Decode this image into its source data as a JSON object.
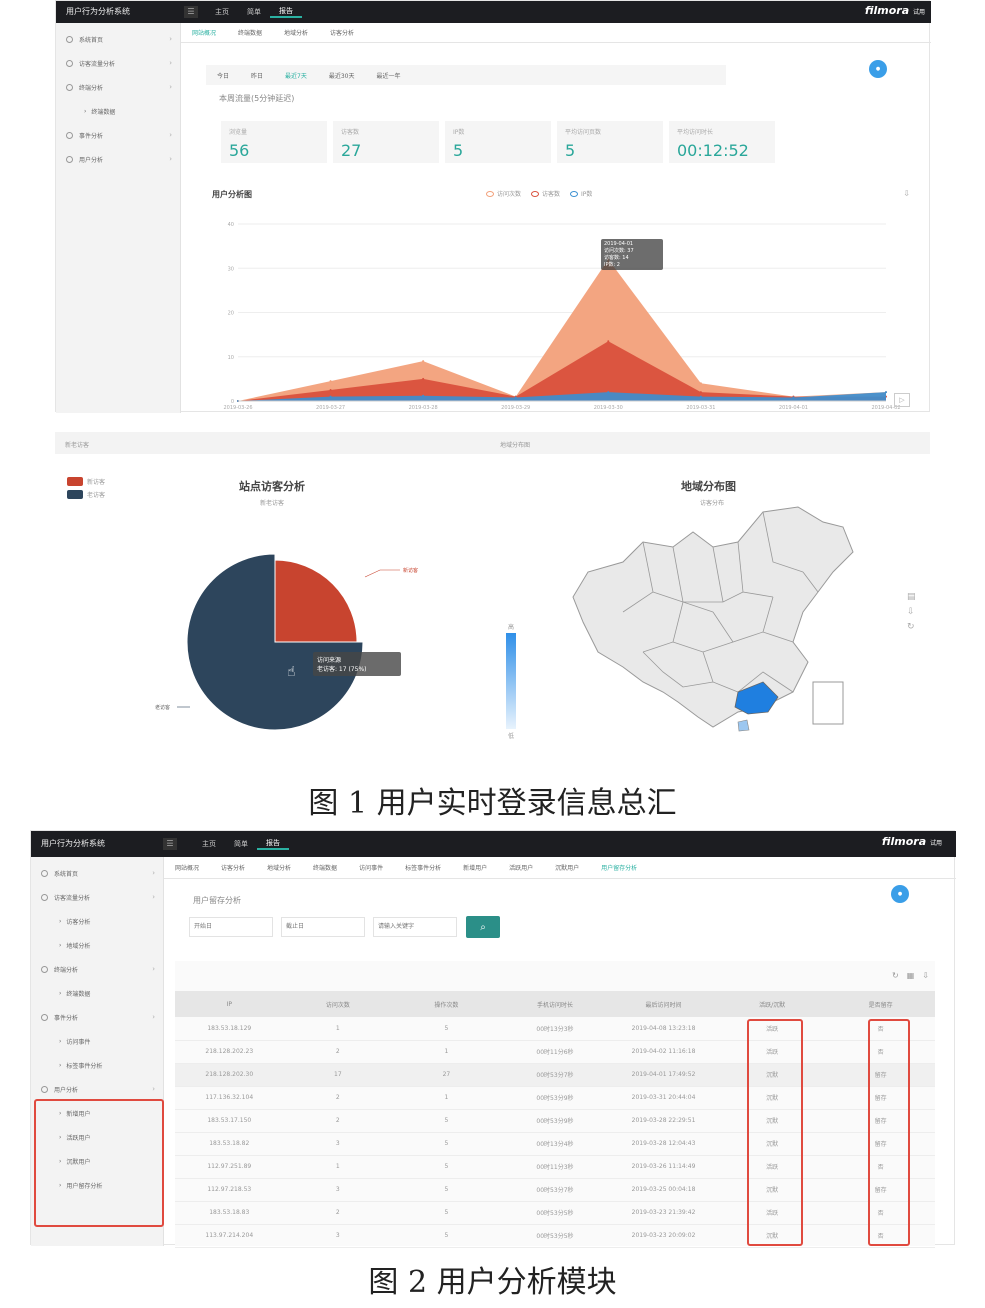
{
  "fig1": {
    "app_title": "用户行为分析系统",
    "brand": "filmora",
    "brand_suffix": "试用",
    "topnav": [
      "主页",
      "简单",
      "报告"
    ],
    "sidebar": [
      {
        "label": "系统首页",
        "sub": false
      },
      {
        "label": "访客流量分析",
        "sub": false
      },
      {
        "label": "终端分析",
        "sub": false
      },
      {
        "label": "终端数据",
        "sub": true
      },
      {
        "label": "事件分析",
        "sub": false
      },
      {
        "label": "用户分析",
        "sub": false
      }
    ],
    "page_tabs": [
      "网站概况",
      "终端数据",
      "地域分析",
      "访客分析"
    ],
    "range_tabs": [
      "今日",
      "昨日",
      "最近7天",
      "最近30天",
      "最近一年"
    ],
    "section_title": "本周流量(5分钟延迟)",
    "stats": [
      {
        "label": "浏览量",
        "value": "56"
      },
      {
        "label": "访客数",
        "value": "27"
      },
      {
        "label": "IP数",
        "value": "5"
      },
      {
        "label": "平均访问页数",
        "value": "5"
      },
      {
        "label": "平均访问时长",
        "value": "00:12:52"
      }
    ],
    "chart_title": "用户分析图",
    "legend": [
      "访问次数",
      "访客数",
      "IP数"
    ],
    "tooltip": [
      "2019-04-01",
      "访问次数: 37",
      "访客数: 14",
      "IP数: 2"
    ],
    "bottom_left_title": "新老访客",
    "bottom_center_title": "地域分布图",
    "pie_legend": [
      "新访客",
      "老访客"
    ],
    "pie_title": "站点访客分析",
    "pie_subtitle": "新老访客",
    "pie_label_new": "新访客",
    "pie_label_old": "老访客",
    "pie_tooltip": [
      "访问来源",
      "老访客: 17 (75%)"
    ],
    "map_title": "地域分布图",
    "map_subtitle": "访客分布",
    "map_scale_high": "高",
    "map_scale_low": "低",
    "caption": "图 1   用户实时登录信息总汇"
  },
  "chart_data": [
    {
      "type": "area",
      "title": "用户分析图",
      "x": [
        "2019-03-26",
        "2019-03-27",
        "2019-03-28",
        "2019-03-29",
        "2019-03-30",
        "2019-03-31",
        "2019-04-01",
        "2019-04-02"
      ],
      "series": [
        {
          "name": "访问次数",
          "values": [
            0,
            4.5,
            9,
            1,
            32,
            4,
            1,
            2
          ]
        },
        {
          "name": "访客数",
          "values": [
            0,
            2.5,
            5,
            1,
            13.5,
            2,
            1,
            1
          ]
        },
        {
          "name": "IP数",
          "values": [
            0,
            1,
            1.2,
            0.8,
            2,
            1,
            0.8,
            2
          ]
        }
      ],
      "ylim": [
        0,
        40
      ],
      "grid": true,
      "legend_position": "top"
    },
    {
      "type": "pie",
      "title": "站点访客分析",
      "labels": [
        "新访客",
        "老访客"
      ],
      "values": [
        25,
        75
      ]
    }
  ],
  "fig2": {
    "app_title": "用户行为分析系统",
    "brand": "filmora",
    "brand_suffix": "试用",
    "topnav": [
      "主页",
      "简单",
      "报告"
    ],
    "sidebar": [
      {
        "label": "系统首页",
        "sub": false
      },
      {
        "label": "访客流量分析",
        "sub": false
      },
      {
        "label": "访客分析",
        "sub": true
      },
      {
        "label": "地域分析",
        "sub": true
      },
      {
        "label": "终端分析",
        "sub": false
      },
      {
        "label": "终端数据",
        "sub": true
      },
      {
        "label": "事件分析",
        "sub": false
      },
      {
        "label": "访问事件",
        "sub": true
      },
      {
        "label": "标签事件分析",
        "sub": true
      },
      {
        "label": "用户分析",
        "sub": false
      },
      {
        "label": "新增用户",
        "sub": true
      },
      {
        "label": "活跃用户",
        "sub": true
      },
      {
        "label": "沉默用户",
        "sub": true
      },
      {
        "label": "用户留存分析",
        "sub": true
      }
    ],
    "tabs": [
      "网站概况",
      "访客分析",
      "地域分析",
      "终端数据",
      "访问事件",
      "标签事件分析",
      "新增用户",
      "活跃用户",
      "沉默用户",
      "用户留存分析"
    ],
    "section_title": "用户留存分析",
    "filters": [
      "开始日",
      "截止日",
      "请输入关键字"
    ],
    "table_headers": [
      "IP",
      "访问次数",
      "操作次数",
      "手机访问时长",
      "最后访问时间",
      "活跃/沉默",
      "是否留存"
    ],
    "rows": [
      [
        "183.53.18.129",
        "1",
        "5",
        "00时13分3秒",
        "2019-04-08 13:23:18",
        "活跃",
        "否"
      ],
      [
        "218.128.202.23",
        "2",
        "1",
        "00时11分6秒",
        "2019-04-02 11:16:18",
        "活跃",
        "否"
      ],
      [
        "218.128.202.30",
        "17",
        "27",
        "00时53分7秒",
        "2019-04-01 17:49:52",
        "沉默",
        "留存"
      ],
      [
        "117.136.32.104",
        "2",
        "1",
        "00时53分9秒",
        "2019-03-31 20:44:04",
        "沉默",
        "留存"
      ],
      [
        "183.53.17.150",
        "2",
        "5",
        "00时53分9秒",
        "2019-03-28 22:29:51",
        "沉默",
        "留存"
      ],
      [
        "183.53.18.82",
        "3",
        "5",
        "00时13分4秒",
        "2019-03-28 12:04:43",
        "沉默",
        "留存"
      ],
      [
        "112.97.251.89",
        "1",
        "5",
        "00时11分3秒",
        "2019-03-26 11:14:49",
        "活跃",
        "否"
      ],
      [
        "112.97.218.53",
        "3",
        "5",
        "00时53分7秒",
        "2019-03-25 00:04:18",
        "沉默",
        "留存"
      ],
      [
        "183.53.18.83",
        "2",
        "5",
        "00时53分5秒",
        "2019-03-23 21:39:42",
        "活跃",
        "否"
      ],
      [
        "113.97.214.204",
        "3",
        "5",
        "00时53分5秒",
        "2019-03-23 20:09:02",
        "沉默",
        "否"
      ]
    ],
    "caption": "图 2   用户分析模块"
  },
  "colors": {
    "accent": "#2bb1a2",
    "area1": "#f2a07a",
    "area2": "#d9503c",
    "area3": "#3a8fd1",
    "pie_new": "#c8442f",
    "pie_old": "#2d455c",
    "highlight": "#e5553f"
  }
}
